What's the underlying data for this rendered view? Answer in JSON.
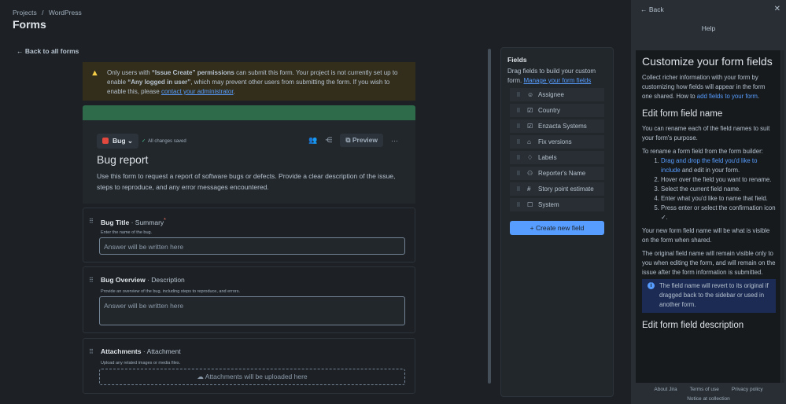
{
  "breadcrumb": {
    "projects": "Projects",
    "sep": "/",
    "project": "WordPress"
  },
  "page_title": "Forms",
  "back_link": "Back to all forms",
  "warning": {
    "pre": "Only users with ",
    "perm": "“Issue Create” permissions",
    "mid": " can submit this form. Your project is not currently set up to enable ",
    "any": "“Any logged in user”",
    "post": ", which may prevent other users from submitting the form. If you wish to enable this, please ",
    "link": "contact your administrator",
    "end": "."
  },
  "form": {
    "issue_type": "Bug",
    "saved": "All changes saved",
    "preview": "Preview",
    "more": "···",
    "title": "Bug report",
    "description": "Use this form to request a report of software bugs or defects. Provide a clear description of the issue, steps to reproduce, and any error messages encountered.",
    "fields": [
      {
        "name": "Bug Title",
        "type": "· Summary",
        "required": "*",
        "help": "Enter the name of the bug.",
        "placeholder": "Answer will be written here"
      },
      {
        "name": "Bug Overview",
        "type": "· Description",
        "help": "Provide an overview of the bug, including steps to reproduce, and errors.",
        "placeholder": "Answer will be written here"
      },
      {
        "name": "Attachments",
        "type": "· Attachment",
        "help": "Upload any related images or media files.",
        "placeholder": "Attachments will be uploaded here"
      }
    ]
  },
  "fields_panel": {
    "title": "Fields",
    "desc": "Drag fields to build your custom form. ",
    "link": "Manage your form fields",
    "items": [
      {
        "label": "Assignee",
        "icon": "☺"
      },
      {
        "label": "Country",
        "icon": "☑"
      },
      {
        "label": "Enzacta Systems",
        "icon": "☑"
      },
      {
        "label": "Fix versions",
        "icon": "⌂"
      },
      {
        "label": "Labels",
        "icon": "♢"
      },
      {
        "label": "Reporter's Name",
        "icon": "⚇"
      },
      {
        "label": "Story point estimate",
        "icon": "#"
      },
      {
        "label": "System",
        "icon": "☐"
      }
    ],
    "create": "Create new field"
  },
  "help": {
    "back": "Back",
    "title": "Help",
    "heading": "Customize your form fields",
    "intro": "Collect richer information with your form by customizing how fields will appear in the form one shared. How to ",
    "intro_link": "add fields to your form",
    "intro_end": ".",
    "h2a": "Edit form field name",
    "p1": "You can rename each of the field names to suit your form's purpose.",
    "p2": "To rename a form field from the form builder:",
    "step1_link": "Drag and drop the field you'd like to include",
    "step1_rest": " and edit in your form.",
    "step2": "Hover over the field you want to rename.",
    "step3": "Select the current field name.",
    "step4": "Enter what you'd like to name that field.",
    "step5": "Press enter or select the confirmation icon ✓.",
    "p3": "Your new form field name will be what is visible on the form when shared.",
    "p4": "The original field name will remain visible only to you when editing the form, and will remain on the issue after the form information is submitted.",
    "info": "The field name will revert to its original if dragged back to the sidebar or used in another form.",
    "h2b": "Edit form field description",
    "footer": {
      "about": "About Jira",
      "terms": "Terms of use",
      "privacy": "Privacy policy",
      "notice": "Notice at collection"
    }
  },
  "colors": {
    "accent": "#579dff",
    "green_banner": "#2d6b4a",
    "warning_bg": "#332e1b",
    "bug": "#e2483d"
  }
}
